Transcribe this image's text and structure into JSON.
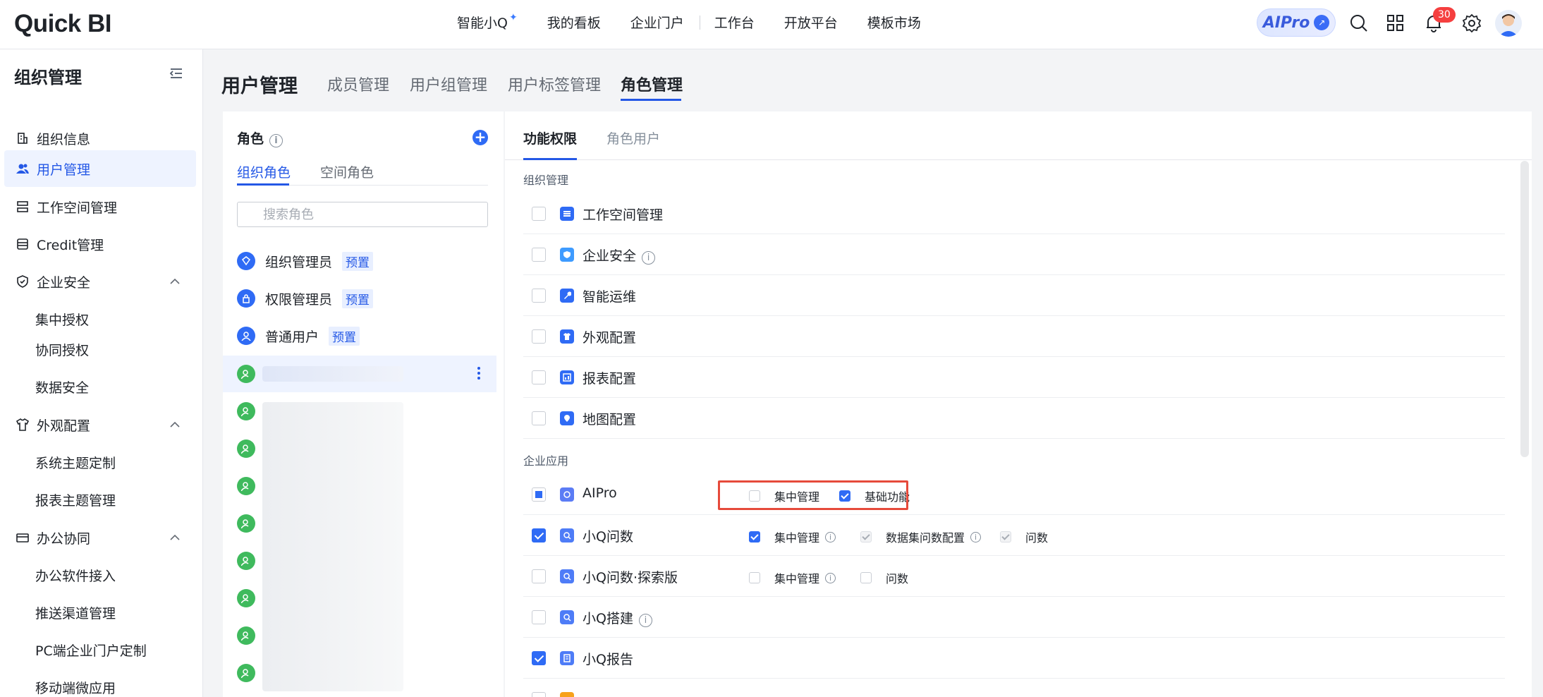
{
  "header": {
    "logo": "Quick BI",
    "nav": [
      "智能小Q",
      "我的看板",
      "企业门户",
      "工作台",
      "开放平台",
      "模板市场"
    ],
    "aipro_label": "AIPro",
    "notification_count": "30",
    "icons": [
      "search-icon",
      "apps-grid-icon",
      "bell-icon",
      "gear-icon",
      "user-avatar"
    ]
  },
  "sidebar": {
    "title": "组织管理",
    "items": [
      {
        "label": "组织信息",
        "icon": "building-icon"
      },
      {
        "label": "用户管理",
        "icon": "users-icon",
        "active": true
      },
      {
        "label": "工作空间管理",
        "icon": "server-icon"
      },
      {
        "label": "Credit管理",
        "icon": "database-icon"
      },
      {
        "label": "企业安全",
        "icon": "shield-icon",
        "expanded": true
      },
      {
        "label": "集中授权"
      },
      {
        "label": "协同授权"
      },
      {
        "label": "数据安全"
      },
      {
        "label": "外观配置",
        "icon": "shirt-icon",
        "expanded": true
      },
      {
        "label": "系统主题定制"
      },
      {
        "label": "报表主题管理"
      },
      {
        "label": "办公协同",
        "icon": "wallet-icon",
        "expanded": true
      },
      {
        "label": "办公软件接入"
      },
      {
        "label": "推送渠道管理"
      },
      {
        "label": "PC端企业门户定制"
      },
      {
        "label": "移动端微应用"
      }
    ]
  },
  "page": {
    "title": "用户管理",
    "tabs": [
      "成员管理",
      "用户组管理",
      "用户标签管理",
      "角色管理"
    ],
    "active_tab": "角色管理"
  },
  "roles": {
    "title": "角色",
    "tabs": [
      "组织角色",
      "空间角色"
    ],
    "search_placeholder": "搜索角色",
    "preset_label": "预置",
    "items": [
      {
        "name": "组织管理员",
        "preset": true
      },
      {
        "name": "权限管理员",
        "preset": true
      },
      {
        "name": "普通用户",
        "preset": true
      }
    ]
  },
  "permissions": {
    "tabs": [
      "功能权限",
      "角色用户"
    ],
    "sections": [
      {
        "title": "组织管理",
        "items": [
          {
            "name": "工作空间管理",
            "checked": false
          },
          {
            "name": "企业安全",
            "checked": false,
            "info": true
          },
          {
            "name": "智能运维",
            "checked": false
          },
          {
            "name": "外观配置",
            "checked": false
          },
          {
            "name": "报表配置",
            "checked": false
          },
          {
            "name": "地图配置",
            "checked": false
          }
        ]
      },
      {
        "title": "企业应用",
        "items": [
          {
            "name": "AIPro",
            "state": "partial",
            "options": [
              {
                "label": "集中管理",
                "checked": false
              },
              {
                "label": "基础功能",
                "checked": true
              }
            ]
          },
          {
            "name": "小Q问数",
            "state": "checked",
            "options": [
              {
                "label": "集中管理",
                "checked": true,
                "info": true
              },
              {
                "label": "数据集问数配置",
                "checked": true,
                "disabled": true,
                "info": true
              },
              {
                "label": "问数",
                "checked": true,
                "disabled": true
              }
            ]
          },
          {
            "name": "小Q问数·探索版",
            "state": "unchecked",
            "options": [
              {
                "label": "集中管理",
                "checked": false,
                "info": true
              },
              {
                "label": "问数",
                "checked": false
              }
            ]
          },
          {
            "name": "小Q搭建",
            "state": "unchecked",
            "info": true
          },
          {
            "name": "小Q报告",
            "state": "checked"
          }
        ]
      }
    ]
  }
}
